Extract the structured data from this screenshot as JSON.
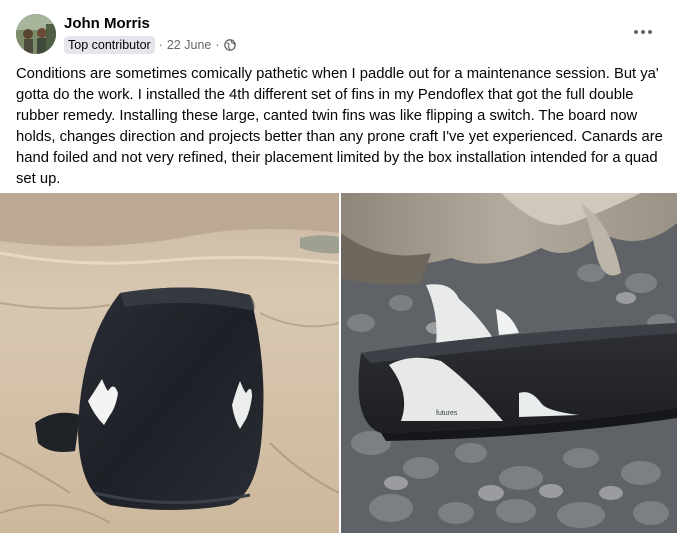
{
  "post": {
    "author": "John Morris",
    "badge": "Top contributor",
    "date": "22 June",
    "separator": "·",
    "body": "Conditions are sometimes comically pathetic when I paddle out for a maintenance session. But ya' gotta do the work. I installed the 4th different set of fins in my Pendoflex that got the full double rubber remedy. Installing these large, canted twin fins was like flipping a switch. The board now holds, changes direction and projects better than any prone craft I've yet experienced. Canards are hand foiled and not very refined, their placement limited by the box installation intended for a quad set up.",
    "fin_brand": "futures"
  },
  "icons": {
    "privacy": "globe-icon",
    "menu": "more-options-icon"
  }
}
